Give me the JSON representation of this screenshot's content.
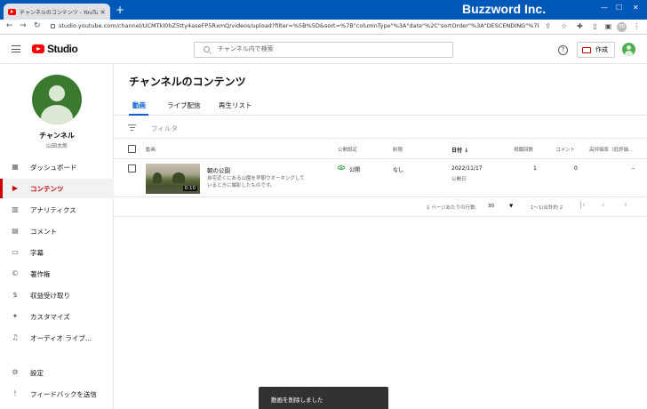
{
  "browser": {
    "tab_title": "チャンネルのコンテンツ - YouTube Studio",
    "tab_close": "×",
    "new_tab": "+",
    "brand_overlay": "Buzzword Inc.",
    "url": "studio.youtube.com/channel/UCMTkI0hZ5tty4aseFP5RxmQ/videos/upload?filter=%5B%5D&sort=%7B\"columnType\"%3A\"date\"%2C\"sortOrder\"%3A\"DESCENDING\"%7D",
    "profile_initial": "BB",
    "icons": [
      "back-arrow",
      "forward-arrow",
      "reload",
      "share",
      "star",
      "extensions",
      "sidebar",
      "profile",
      "more"
    ]
  },
  "header": {
    "logo_text": "Studio",
    "search_placeholder": "チャンネル内で検索",
    "help_label": "?",
    "create_label": "作成"
  },
  "sidebar": {
    "channel_title": "チャンネル",
    "channel_user": "山田太郎",
    "items": [
      {
        "label": "ダッシュボード",
        "icon": "dashboard-icon",
        "glyph": "▦"
      },
      {
        "label": "コンテンツ",
        "icon": "content-icon",
        "glyph": "▶"
      },
      {
        "label": "アナリティクス",
        "icon": "analytics-icon",
        "glyph": "▥"
      },
      {
        "label": "コメント",
        "icon": "comments-icon",
        "glyph": "▤"
      },
      {
        "label": "字幕",
        "icon": "subtitles-icon",
        "glyph": "▭"
      },
      {
        "label": "著作権",
        "icon": "copyright-icon",
        "glyph": "©"
      },
      {
        "label": "収益受け取り",
        "icon": "earn-icon",
        "glyph": "$"
      },
      {
        "label": "カスタマイズ",
        "icon": "customize-icon",
        "glyph": "✦"
      },
      {
        "label": "オーディオ ライブ...",
        "icon": "audio-library-icon",
        "glyph": "♫"
      }
    ],
    "settings_label": "設定",
    "feedback_label": "フィードバックを送信"
  },
  "main": {
    "page_title": "チャンネルのコンテンツ",
    "tabs": [
      "動画",
      "ライブ配信",
      "再生リスト"
    ],
    "filter_label": "フィルタ",
    "columns": {
      "video": "動画",
      "visibility": "公開設定",
      "restrictions": "制限",
      "date": "日付 ↓",
      "views": "視聴回数",
      "comments": "コメント",
      "likes": "高評価率（低評価..."
    },
    "rows": [
      {
        "title": "朝の公園",
        "description": "自宅近くにある公園を早朝ウオーキングしているときに撮影したものです。",
        "duration": "0:10",
        "visibility": "公開",
        "restrictions": "なし",
        "date": "2022/11/17",
        "date_status": "公開日",
        "views": "1",
        "comments": "0",
        "likes": "–"
      }
    ],
    "pagination": {
      "rows_per_page_label": "1 ページあたりの行数:",
      "rows_per_page": "30",
      "range": "1〜1/合計約 2"
    }
  },
  "snackbar": {
    "message": "動画を削除しました"
  },
  "colors": {
    "accent_red": "#cc0000",
    "link_blue": "#065fd4",
    "browser_blue": "#0058b8",
    "public_green": "#2ba640"
  }
}
